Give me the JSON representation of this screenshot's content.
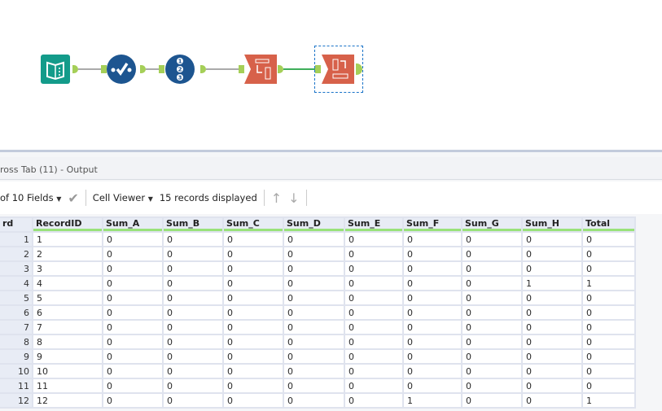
{
  "canvas": {
    "tools": [
      {
        "name": "input-data-tool",
        "color": "#139b8a"
      },
      {
        "name": "select-tool",
        "color": "#1d5590"
      },
      {
        "name": "record-id-tool",
        "color": "#1d5590"
      },
      {
        "name": "transpose-tool",
        "color": "#d7614a"
      },
      {
        "name": "cross-tab-tool",
        "color": "#d7614a"
      }
    ]
  },
  "results": {
    "title": "ross Tab (11) - Output",
    "fields_label": "of 10 Fields",
    "cell_viewer_label": "Cell Viewer",
    "records_label": "15 records displayed",
    "columns": [
      "rd",
      "RecordID",
      "Sum_A",
      "Sum_B",
      "Sum_C",
      "Sum_D",
      "Sum_E",
      "Sum_F",
      "Sum_G",
      "Sum_H",
      "Total"
    ],
    "rows": [
      [
        "1",
        "1",
        "0",
        "0",
        "0",
        "0",
        "0",
        "0",
        "0",
        "0",
        "0"
      ],
      [
        "2",
        "2",
        "0",
        "0",
        "0",
        "0",
        "0",
        "0",
        "0",
        "0",
        "0"
      ],
      [
        "3",
        "3",
        "0",
        "0",
        "0",
        "0",
        "0",
        "0",
        "0",
        "0",
        "0"
      ],
      [
        "4",
        "4",
        "0",
        "0",
        "0",
        "0",
        "0",
        "0",
        "0",
        "1",
        "1"
      ],
      [
        "5",
        "5",
        "0",
        "0",
        "0",
        "0",
        "0",
        "0",
        "0",
        "0",
        "0"
      ],
      [
        "6",
        "6",
        "0",
        "0",
        "0",
        "0",
        "0",
        "0",
        "0",
        "0",
        "0"
      ],
      [
        "7",
        "7",
        "0",
        "0",
        "0",
        "0",
        "0",
        "0",
        "0",
        "0",
        "0"
      ],
      [
        "8",
        "8",
        "0",
        "0",
        "0",
        "0",
        "0",
        "0",
        "0",
        "0",
        "0"
      ],
      [
        "9",
        "9",
        "0",
        "0",
        "0",
        "0",
        "0",
        "0",
        "0",
        "0",
        "0"
      ],
      [
        "10",
        "10",
        "0",
        "0",
        "0",
        "0",
        "0",
        "0",
        "0",
        "0",
        "0"
      ],
      [
        "11",
        "11",
        "0",
        "0",
        "0",
        "0",
        "0",
        "0",
        "0",
        "0",
        "0"
      ],
      [
        "12",
        "12",
        "0",
        "0",
        "0",
        "0",
        "0",
        "1",
        "0",
        "0",
        "1"
      ]
    ]
  }
}
